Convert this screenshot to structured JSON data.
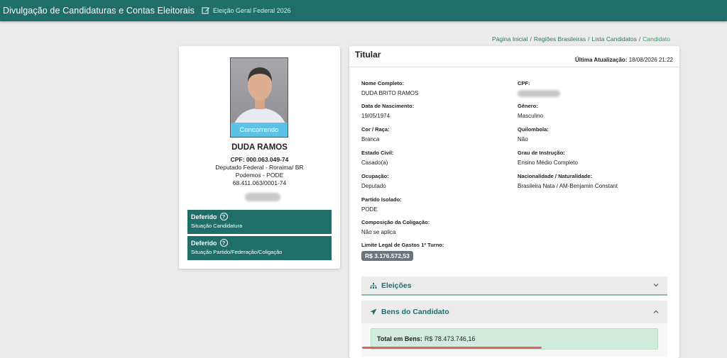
{
  "header": {
    "app_title": "Divulgação de Candidaturas e Contas Eleitorais",
    "election": "Eleição Geral Federal 2026"
  },
  "breadcrumb": {
    "items": [
      "Página Inicial",
      "Regiões Brasileiras",
      "Lista Candidatos"
    ],
    "current": "Candidato",
    "separator": "/"
  },
  "candidate": {
    "photo_status": "Concorrendo",
    "name": "DUDA RAMOS",
    "cpf_line": "CPF: 000.063.049-74",
    "role_line": "Deputado Federal - Roraima/ BR",
    "party_line": "Podemos - PODE",
    "cnpj_line": "68.411.063/0001-74",
    "status_boxes": [
      {
        "title": "Deferido",
        "subtitle": "Situação Candidatura"
      },
      {
        "title": "Deferido",
        "subtitle": "Situação Partido/Federação/Coligação"
      }
    ]
  },
  "panel": {
    "title": "Titular",
    "last_update_label": "Última Atualização:",
    "last_update_value": "18/08/2026 21:22",
    "fields_left": [
      {
        "label": "Nome Completo:",
        "value": "DUDA BRITO RAMOS"
      },
      {
        "label": "Data de Nascimento:",
        "value": "19/05/1974"
      },
      {
        "label": "Cor / Raça:",
        "value": "Branca"
      },
      {
        "label": "Estado Civil:",
        "value": "Casado(a)"
      },
      {
        "label": "Ocupação:",
        "value": "Deputado"
      },
      {
        "label": "Partido Isolado:",
        "value": "PODE"
      },
      {
        "label": "Composição da Coligação:",
        "value": "Não se aplica"
      }
    ],
    "fields_right": [
      {
        "label": "CPF:",
        "value": ""
      },
      {
        "label": "Gênero:",
        "value": "Masculino"
      },
      {
        "label": "Quilombola:",
        "value": "Não"
      },
      {
        "label": "Grau de Instrução:",
        "value": "Ensino Médio Completo"
      },
      {
        "label": "Nacionalidade / Naturalidade:",
        "value": "Brasileira Nata / AM-Benjamin Constant"
      }
    ],
    "limit_label": "Limite Legal de Gastos 1º Turno:",
    "limit_value": "R$ 3.176.572,53",
    "accordion": [
      {
        "title": "Eleições",
        "icon": "sitemap-icon",
        "expanded": false
      },
      {
        "title": "Bens do Candidato",
        "icon": "send-icon",
        "expanded": true
      }
    ],
    "total_label": "Total em Bens:",
    "total_value": "R$ 78.473.746,16"
  },
  "colors": {
    "primary": "#1f6e6a",
    "status_badge": "#5bc4e6",
    "success_bg": "#d1ecdc",
    "annotation_red": "#ea5d64"
  }
}
